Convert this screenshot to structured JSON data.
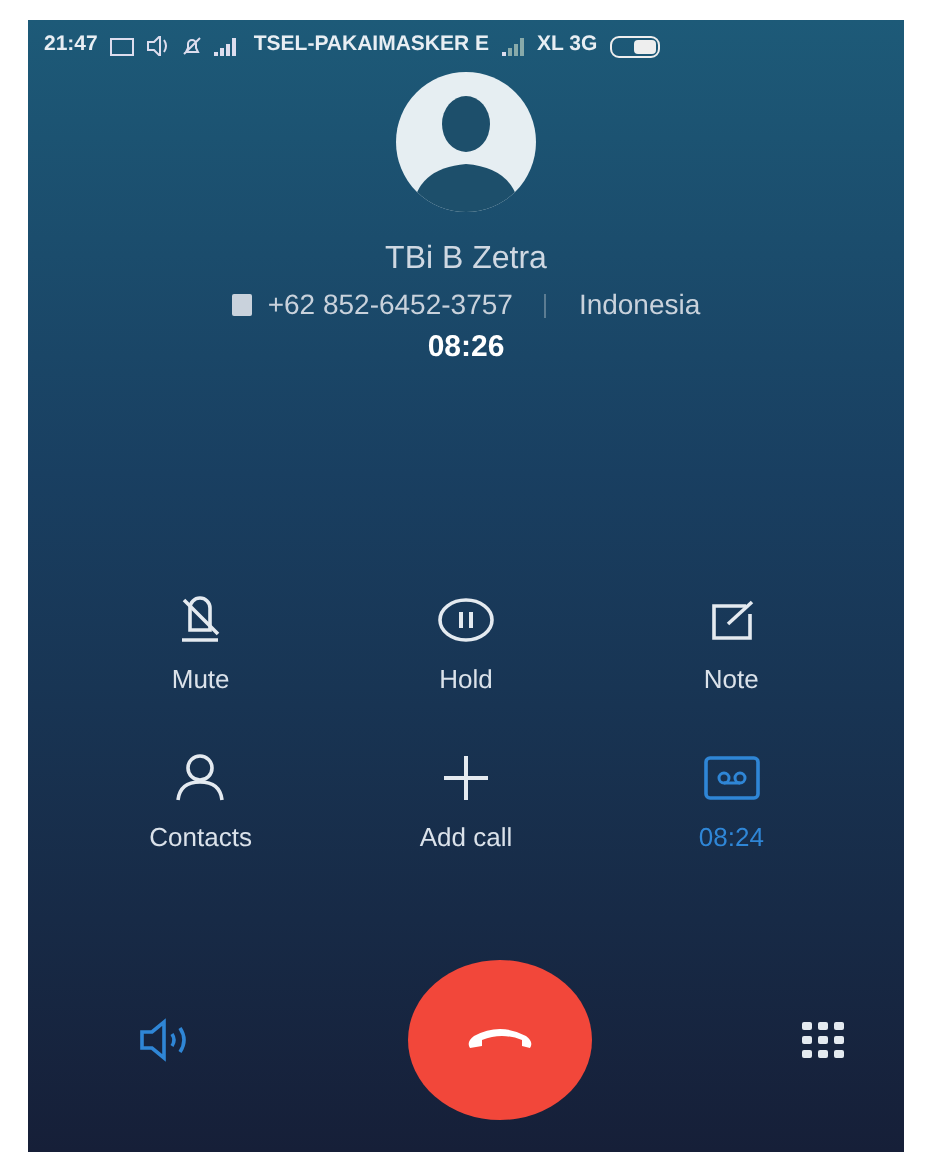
{
  "status_bar": {
    "time": "21:47",
    "carrier_1": "TSEL-PAKAIMASKER E",
    "carrier_2": "XL 3G"
  },
  "contact": {
    "name": "TBi B Zetra",
    "number": "+62 852-6452-3757",
    "region": "Indonesia",
    "duration": "08:26"
  },
  "actions": [
    {
      "kind": "mute",
      "label": "Mute",
      "active": false
    },
    {
      "kind": "hold",
      "label": "Hold",
      "active": false
    },
    {
      "kind": "note",
      "label": "Note",
      "active": false
    },
    {
      "kind": "contacts",
      "label": "Contacts",
      "active": false
    },
    {
      "kind": "add",
      "label": "Add call",
      "active": false
    },
    {
      "kind": "record",
      "label": "08:24",
      "active": true
    }
  ],
  "bottom": {
    "speaker_on": true
  }
}
